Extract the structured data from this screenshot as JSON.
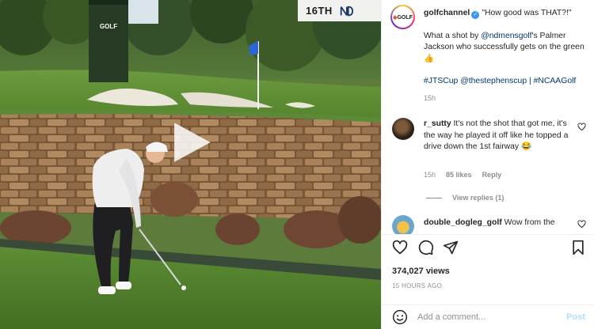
{
  "video": {
    "scoreboard_hole": "16TH",
    "tower_logo": "GOLF"
  },
  "post": {
    "avatar_logo": "GOLF",
    "username": "golfchannel",
    "verified_icon": "✓",
    "title_quote": "\"How good was THAT?!\"",
    "text_1": "What a shot by ",
    "mention_1": "@ndmensgolf",
    "text_2": "'s Palmer Jackson who successfully gets on the green 👍",
    "hashtags": "#JTSCup @thestephenscup | #NCAAGolf",
    "time": "15h"
  },
  "comments": [
    {
      "username": "r_sutty",
      "text": "It's not the shot that got me, it's the way he played it off like he topped a drive down the 1st fairway 😂",
      "time": "15h",
      "likes": "85 likes",
      "reply": "Reply",
      "view_replies": "View replies (1)"
    },
    {
      "username": "double_dogleg_golf",
      "text": "Wow from the"
    }
  ],
  "actions": {
    "views": "374,027 views",
    "ago": "15 HOURS AGO"
  },
  "add_comment": {
    "placeholder": "Add a comment...",
    "post_label": "Post"
  },
  "icons": {
    "like": "heart-icon",
    "comment": "comment-icon",
    "share": "paper-plane-icon",
    "save": "bookmark-icon",
    "emoji": "smiley-icon",
    "play": "play-icon"
  },
  "colors": {
    "link": "#00376b",
    "verified": "#3897f0",
    "meta": "#8e8e8e",
    "post_disabled": "#b2dffc"
  }
}
